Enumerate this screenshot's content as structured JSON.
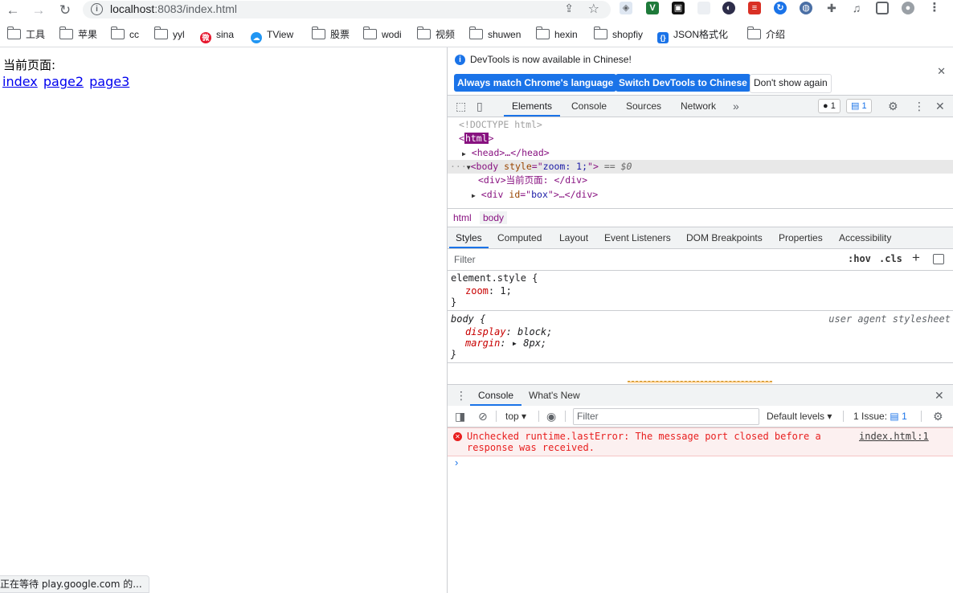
{
  "toolbar": {
    "url_host": "localhost",
    "url_rest": ":8083/index.html"
  },
  "bookmarks": [
    {
      "label": "工具",
      "icon": "folder-icon"
    },
    {
      "label": "苹果",
      "icon": "folder-icon"
    },
    {
      "label": "cc",
      "icon": "folder-icon"
    },
    {
      "label": "yyl",
      "icon": "folder-icon"
    },
    {
      "label": "sina",
      "icon": "weibo-icon"
    },
    {
      "label": "TView",
      "icon": "cloud-icon"
    },
    {
      "label": "股票",
      "icon": "folder-icon"
    },
    {
      "label": "wodi",
      "icon": "folder-icon"
    },
    {
      "label": "视频",
      "icon": "folder-icon"
    },
    {
      "label": "shuwen",
      "icon": "folder-icon"
    },
    {
      "label": "hexin",
      "icon": "folder-icon"
    },
    {
      "label": "shopfiy",
      "icon": "folder-icon"
    },
    {
      "label": "JSON格式化",
      "icon": "json-icon"
    },
    {
      "label": "介绍",
      "icon": "folder-icon"
    }
  ],
  "page": {
    "label": "当前页面:",
    "links": [
      "index",
      "page2",
      "page3"
    ],
    "status": "正在等待 play.google.com 的..."
  },
  "devtools": {
    "infobar": {
      "message": "DevTools is now available in Chinese!",
      "btn_match": "Always match Chrome's language",
      "btn_switch": "Switch DevTools to Chinese",
      "btn_dismiss": "Don't show again"
    },
    "tabs": [
      "Elements",
      "Console",
      "Sources",
      "Network"
    ],
    "error_count": "1",
    "message_count": "1",
    "dom": {
      "doctype": "<!DOCTYPE html>",
      "html_open": "<",
      "html_tag": "html",
      "html_close": ">",
      "head": "<head>…</head>",
      "body_tag": "<body ",
      "body_attr": "style",
      "body_eq": "=\"",
      "body_val": "zoom: 1;",
      "body_end": "\">",
      "body_ref": " == $0",
      "div1": "<div>当前页面: </div>",
      "div2_open": "<div ",
      "div2_attr": "id",
      "div2_eq": "=\"",
      "div2_val": "box",
      "div2_end": "\">…</div>"
    },
    "breadcrumbs": [
      "html",
      "body"
    ],
    "style_tabs": [
      "Styles",
      "Computed",
      "Layout",
      "Event Listeners",
      "DOM Breakpoints",
      "Properties",
      "Accessibility"
    ],
    "filter_placeholder": "Filter",
    "hov": ":hov",
    "cls": ".cls",
    "rules": {
      "r1_selector": "element.style {",
      "r1_prop": "zoom",
      "r1_val": ": 1;",
      "r1_close": "}",
      "r2_selector": "body {",
      "r2_source": "user agent stylesheet",
      "r2_p1": "display",
      "r2_v1": ": block;",
      "r2_p2": "margin",
      "r2_v2": ": ▸ 8px;",
      "r2_close": "}"
    },
    "drawer_tabs": [
      "Console",
      "What's New"
    ],
    "console": {
      "context": "top ▾",
      "filter_placeholder": "Filter",
      "levels": "Default levels ▾",
      "issues": "1 Issue:",
      "issues_count": "1",
      "error_text": "Unchecked runtime.lastError: The message port closed before a response was received.",
      "error_source": "index.html:1",
      "prompt": "›"
    }
  },
  "colors": {
    "accent": "#1a73e8",
    "error": "#e81e1e",
    "tag": "#881280",
    "link": "#0000ee"
  }
}
